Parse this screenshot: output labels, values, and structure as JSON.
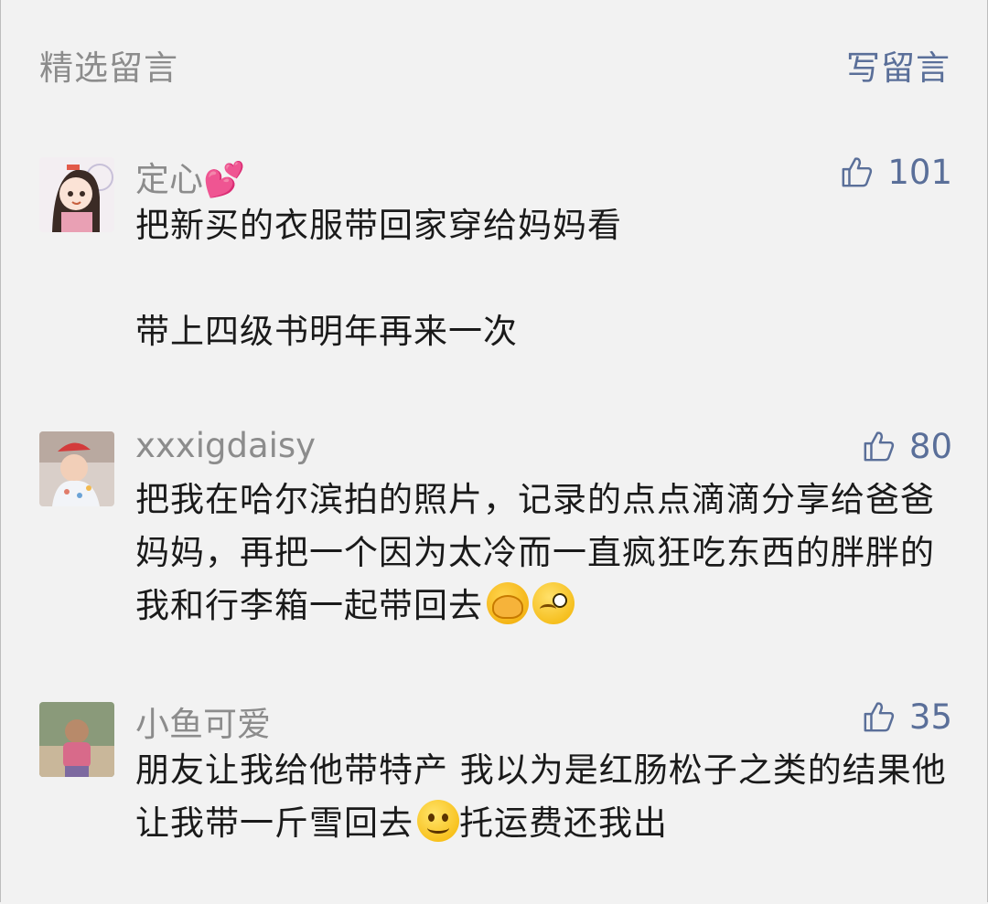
{
  "header": {
    "title": "精选留言",
    "write_label": "写留言"
  },
  "colors": {
    "accent": "#5a6f99",
    "muted_text": "#8c8c8c",
    "body_text": "#1a1a1a",
    "background": "#f2f2f2"
  },
  "comments": [
    {
      "name": "定心💕",
      "likes": "101",
      "paragraphs": [
        "把新买的衣服带回家穿给妈妈看",
        "带上四级书明年再来一次"
      ]
    },
    {
      "name": "xxxigdaisy",
      "likes": "80",
      "paragraphs": [
        "把我在哈尔滨拍的照片，记录的点点滴滴分享给爸爸妈妈，再把一个因为太冷而一直疯狂吃东西的胖胖的我和行李箱一起带回去"
      ],
      "emojis": [
        "facepalm-emoji",
        "wink-emoji"
      ]
    },
    {
      "name": "小鱼可爱",
      "likes": "35",
      "text_before_emoji": "朋友让我给他带特产 我以为是红肠松子之类的结果他让我带一斤雪回去",
      "text_after_emoji": "托运费还我出",
      "emojis": [
        "smile-emoji"
      ]
    }
  ]
}
